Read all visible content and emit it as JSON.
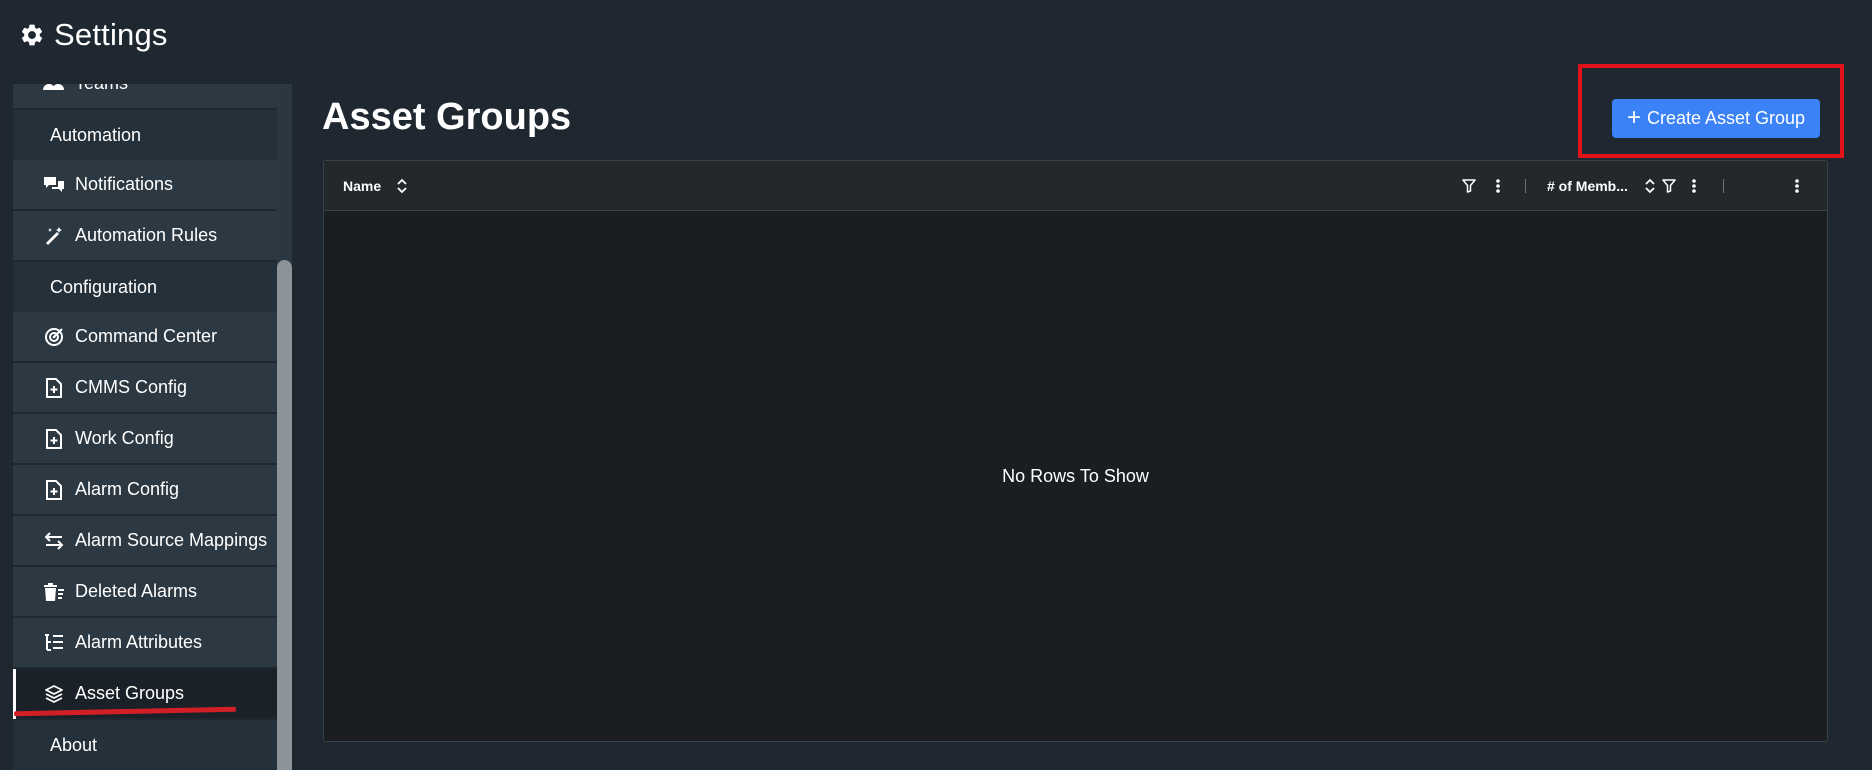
{
  "header": {
    "title": "Settings",
    "icon": "gear-icon"
  },
  "sidebar": {
    "items": [
      {
        "label": "Teams",
        "icon": "teams-icon",
        "type": "item"
      },
      {
        "label": "Automation",
        "type": "section"
      },
      {
        "label": "Notifications",
        "icon": "chat-bubbles-icon",
        "type": "item"
      },
      {
        "label": "Automation Rules",
        "icon": "magic-wand-icon",
        "type": "item"
      },
      {
        "label": "Configuration",
        "type": "section"
      },
      {
        "label": "Command Center",
        "icon": "target-icon",
        "type": "item"
      },
      {
        "label": "CMMS Config",
        "icon": "file-plus-icon",
        "type": "item"
      },
      {
        "label": "Work Config",
        "icon": "file-plus-icon",
        "type": "item"
      },
      {
        "label": "Alarm Config",
        "icon": "file-plus-icon",
        "type": "item"
      },
      {
        "label": "Alarm Source Mappings",
        "icon": "swap-arrows-icon",
        "type": "item"
      },
      {
        "label": "Deleted Alarms",
        "icon": "trash-list-icon",
        "type": "item"
      },
      {
        "label": "Alarm Attributes",
        "icon": "tree-list-icon",
        "type": "item"
      },
      {
        "label": "Asset Groups",
        "icon": "layers-icon",
        "type": "item",
        "active": true
      },
      {
        "label": "About",
        "type": "section"
      }
    ]
  },
  "main": {
    "title": "Asset Groups",
    "create_button": "Create Asset Group",
    "grid": {
      "columns": [
        {
          "label": "Name",
          "sortable": true,
          "filterable": true
        },
        {
          "label": "# of Memb...",
          "sortable": true,
          "filterable": true
        },
        {
          "label": "",
          "sortable": false,
          "filterable": false
        }
      ],
      "empty_message": "No Rows To Show"
    }
  },
  "colors": {
    "background": "#1f2830",
    "nav_item": "#2c3943",
    "nav_active": "#1a2128",
    "accent": "#3b82f6",
    "highlight": "#e0131b"
  }
}
